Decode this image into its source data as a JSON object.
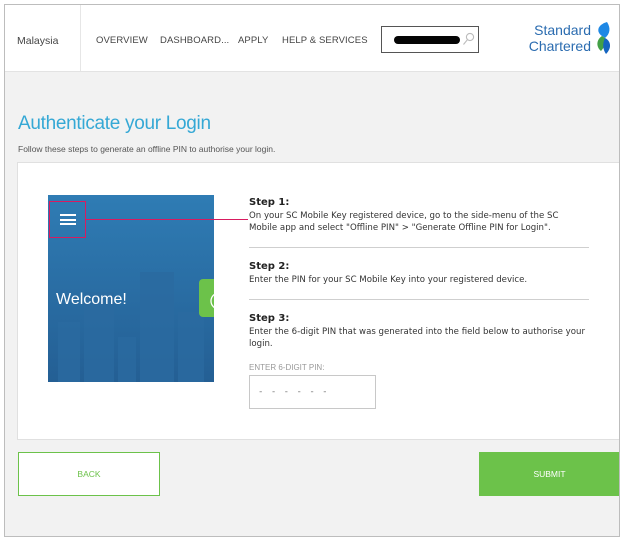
{
  "header": {
    "country": "Malaysia",
    "nav": [
      {
        "label": "OVERVIEW"
      },
      {
        "label": "DASHBOARD..."
      },
      {
        "label": "APPLY"
      },
      {
        "label": "HELP & SERVICES"
      }
    ],
    "logo_line1": "Standard",
    "logo_line2": "Chartered"
  },
  "page": {
    "title": "Authenticate your Login",
    "subtitle": "Follow these steps to generate an offline PIN to authorise your login."
  },
  "illustration": {
    "welcome": "Welcome!"
  },
  "steps": [
    {
      "title": "Step 1:",
      "text": "On your SC Mobile Key registered device, go to the side-menu of the SC Mobile app and select \"Offline PIN\" > \"Generate Offline PIN for Login\"."
    },
    {
      "title": "Step 2:",
      "text": "Enter the PIN for your SC Mobile Key into your registered device."
    },
    {
      "title": "Step 3:",
      "text": "Enter the 6-digit PIN that was generated into the field below to authorise your login."
    }
  ],
  "pin": {
    "label": "ENTER 6-DIGIT PIN:",
    "placeholder": "- - - - - -",
    "value": ""
  },
  "buttons": {
    "back": "BACK",
    "submit": "SUBMIT"
  },
  "colors": {
    "brand_blue": "#2b6cb0",
    "title_blue": "#35a8d5",
    "accent_green": "#6cc24a",
    "highlight_pink": "#d81b60"
  }
}
